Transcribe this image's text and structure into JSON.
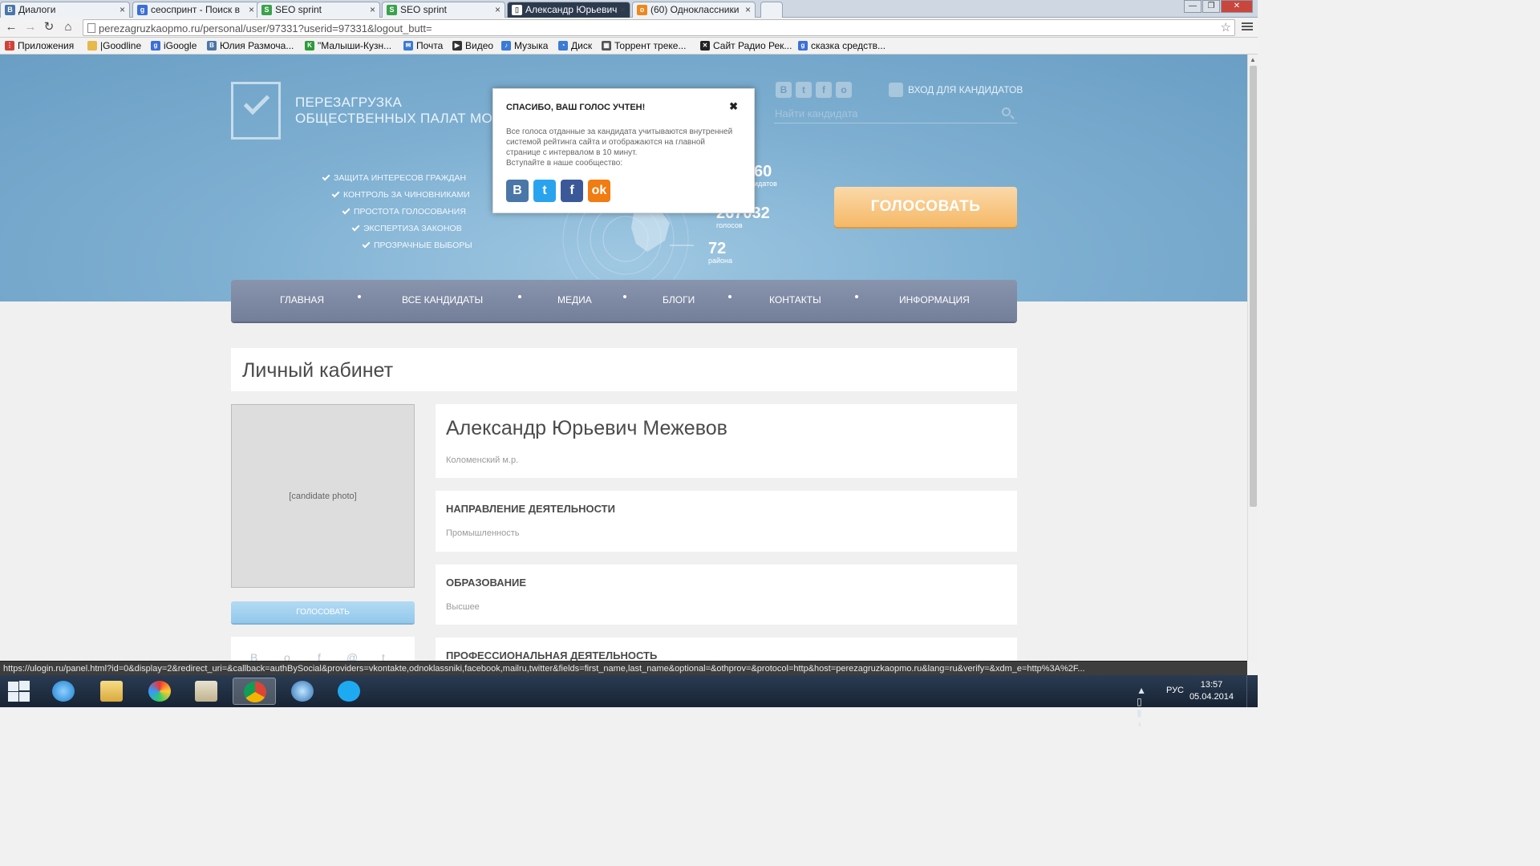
{
  "tabs": [
    {
      "title": "Диалоги",
      "icon": "chat-icon",
      "icon_color": "#4a76a8",
      "glyph": "В",
      "extra": "◂×"
    },
    {
      "title": "сеоспринт - Поиск в",
      "icon": "google-icon",
      "icon_color": "#3b6fd8",
      "glyph": "g"
    },
    {
      "title": "SEO sprint",
      "icon": "seosprint-icon",
      "icon_color": "#3aa24a",
      "glyph": "S"
    },
    {
      "title": "SEO sprint",
      "icon": "seosprint-icon",
      "icon_color": "#3aa24a",
      "glyph": "S"
    },
    {
      "title": "Александр Юрьевич",
      "icon": "page-icon",
      "icon_color": "#ffffff",
      "glyph": "▯"
    },
    {
      "title": "(60) Одноклассники",
      "icon": "odnoklassniki-icon",
      "icon_color": "#f0871b",
      "glyph": "o"
    }
  ],
  "tab_close": "×",
  "window_controls": {
    "minimize": "—",
    "maximize": "❐",
    "close": "✕"
  },
  "toolbar": {
    "back": "←",
    "forward": "→",
    "reload": "↻",
    "home": "⌂",
    "url": "perezagruzkaopmo.ru/personal/user/97331?userid=97331&logout_butt=",
    "star": "☆"
  },
  "bookmarks": [
    {
      "label": "Приложения",
      "icon": "apps-icon",
      "color": "#d04437",
      "glyph": "⋮"
    },
    {
      "label": "|Goodline",
      "icon": "folder-icon",
      "color": "#e7b84a",
      "glyph": ""
    },
    {
      "label": "iGoogle",
      "icon": "google-icon",
      "color": "#3b6fd8",
      "glyph": "g"
    },
    {
      "label": "Юлия Размоча...",
      "icon": "vk-icon",
      "color": "#4a76a8",
      "glyph": "В"
    },
    {
      "label": "\"Малыши-Кузн...",
      "icon": "k-icon",
      "color": "#2e9a3a",
      "glyph": "K"
    },
    {
      "label": "Почта",
      "icon": "mail-icon",
      "color": "#3a7bd5",
      "glyph": "✉"
    },
    {
      "label": "Видео",
      "icon": "video-icon",
      "color": "#333333",
      "glyph": "▶"
    },
    {
      "label": "Музыка",
      "icon": "music-icon",
      "color": "#3a7bd5",
      "glyph": "♪"
    },
    {
      "label": "Диск",
      "icon": "disk-icon",
      "color": "#3a7bd5",
      "glyph": "◔"
    },
    {
      "label": "Торрент треке...",
      "icon": "torrent-icon",
      "color": "#555555",
      "glyph": "▦"
    },
    {
      "label": "Сайт Радио Рек...",
      "icon": "radio-icon",
      "color": "#222222",
      "glyph": "✕"
    },
    {
      "label": "сказка средств...",
      "icon": "google-icon",
      "color": "#3b6fd8",
      "glyph": "g"
    }
  ],
  "site": {
    "title_line1": "Перезагрузка",
    "title_line2": "общественных палат МО",
    "features": [
      "Защита интересов граждан",
      "Контроль за чиновниками",
      "Простота голосования",
      "Экспертиза законов",
      "Прозрачные выборы"
    ],
    "stats": [
      {
        "value": "60",
        "label": "идатов"
      },
      {
        "value": "267032",
        "label": "голосов"
      },
      {
        "value": "72",
        "label": "района"
      }
    ],
    "social_icons": [
      "В",
      "t",
      "f",
      "o"
    ],
    "login_label": "Вход для кандидатов",
    "search_placeholder": "Найти кандидата",
    "vote_button": "Голосовать",
    "nav": [
      "Главная",
      "Все кандидаты",
      "Медиа",
      "Блоги",
      "Контакты",
      "Информация"
    ]
  },
  "modal": {
    "title": "Спасибо, ваш голос учтен!",
    "close": "✖",
    "body": "Все голоса отданные за кандидата учитываются внутренней системой рейтинга сайта и отображаются на главной странице с интервалом в 10 минут.",
    "invite": "Вступайте в наше сообщество:",
    "socials": [
      {
        "name": "vk",
        "glyph": "В",
        "color": "#4a76a8"
      },
      {
        "name": "twitter",
        "glyph": "t",
        "color": "#2aa3ef"
      },
      {
        "name": "facebook",
        "glyph": "f",
        "color": "#3b5998"
      },
      {
        "name": "odnoklassniki",
        "glyph": "ok",
        "color": "#f07c12"
      }
    ]
  },
  "profile": {
    "page_title": "Личный кабинет",
    "name": "Александр Юрьевич Межевов",
    "district": "Коломенский м.р.",
    "vote_button": "Голосовать",
    "sections": [
      {
        "heading": "Направление деятельности",
        "value": "Промышленность"
      },
      {
        "heading": "Образование",
        "value": "Высшее"
      },
      {
        "heading": "Профессиональная деятельность",
        "value": ""
      }
    ],
    "share_icons": [
      "В",
      "о",
      "f",
      "@",
      "t"
    ]
  },
  "status_url": "https://ulogin.ru/panel.html?id=0&display=2&redirect_uri=&callback=authBySocial&providers=vkontakte,odnoklassniki,facebook,mailru,twitter&fields=first_name,last_name&optional=&othprov=&protocol=http&host=perezagruzkaopmo.ru&lang=ru&verify=&xdm_e=http%3A%2F...",
  "taskbar": {
    "lang": "РУС",
    "time": "13:57",
    "date": "05.04.2014",
    "tray_icons": "▲ ▯ ▮ ◖"
  },
  "colors": {
    "hero": "#7fb0d2",
    "nav": "#7b86a0",
    "vote_orange": "#f5b866",
    "vote_blue": "#93c8eb"
  }
}
